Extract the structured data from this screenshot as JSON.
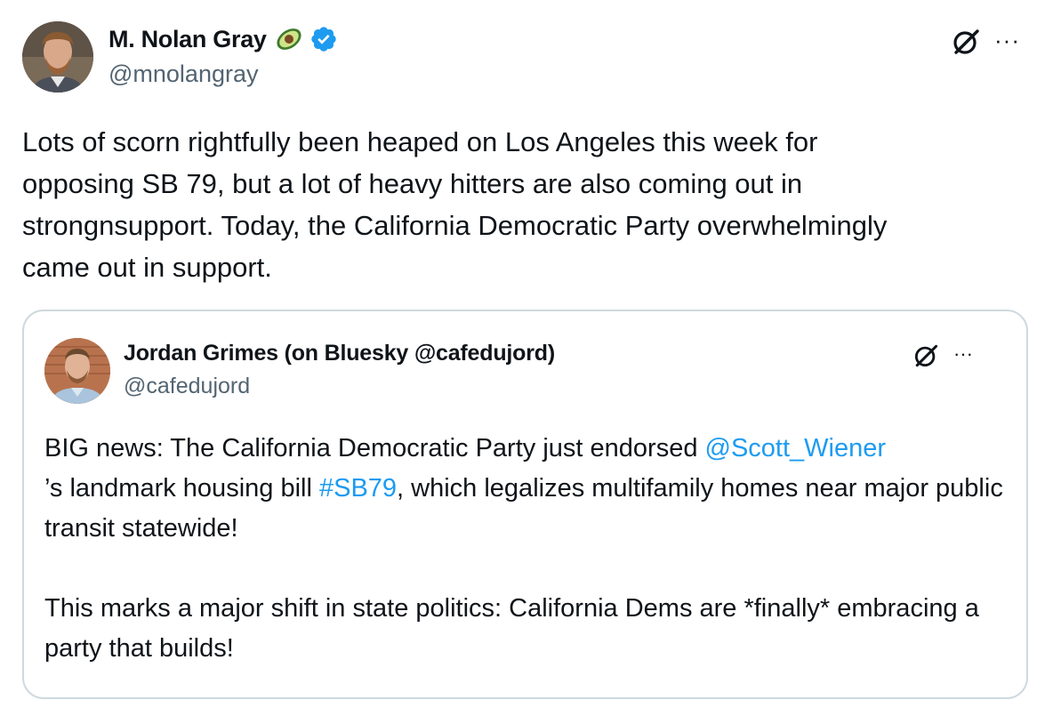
{
  "main_tweet": {
    "author": {
      "name": "M. Nolan Gray",
      "handle": "@mnolangray",
      "name_emoji": "avocado-emoji",
      "verified": true
    },
    "lines": [
      "Lots of scorn rightfully been heaped on Los Angeles this week for",
      "opposing SB 79, but a lot of heavy hitters are also coming out in",
      "strongnsupport. Today, the California Democratic Party overwhelmingly",
      "came out in support."
    ]
  },
  "quoted_tweet": {
    "author": {
      "name": "Jordan Grimes (on Bluesky @cafedujord)",
      "handle": "@cafedujord"
    },
    "paragraph1": {
      "part1": "BIG news: The California Democratic Party just endorsed ",
      "mention": "@Scott_Wiener",
      "part2": "’s landmark housing bill ",
      "hashtag": "#SB79",
      "part3": ", which legalizes multifamily homes near major public transit statewide!"
    },
    "paragraph2": "This marks a major shift in state politics: California Dems are *finally* embracing a party that builds!"
  },
  "icons": {
    "more": "more-horizontal-icon",
    "grok": "grok-icon",
    "verified": "verified-badge-icon"
  },
  "colors": {
    "link": "#1d9bf0",
    "secondary_text": "#536471",
    "border": "#cfd9de",
    "verified": "#1d9bf0"
  },
  "more_glyph": "···"
}
